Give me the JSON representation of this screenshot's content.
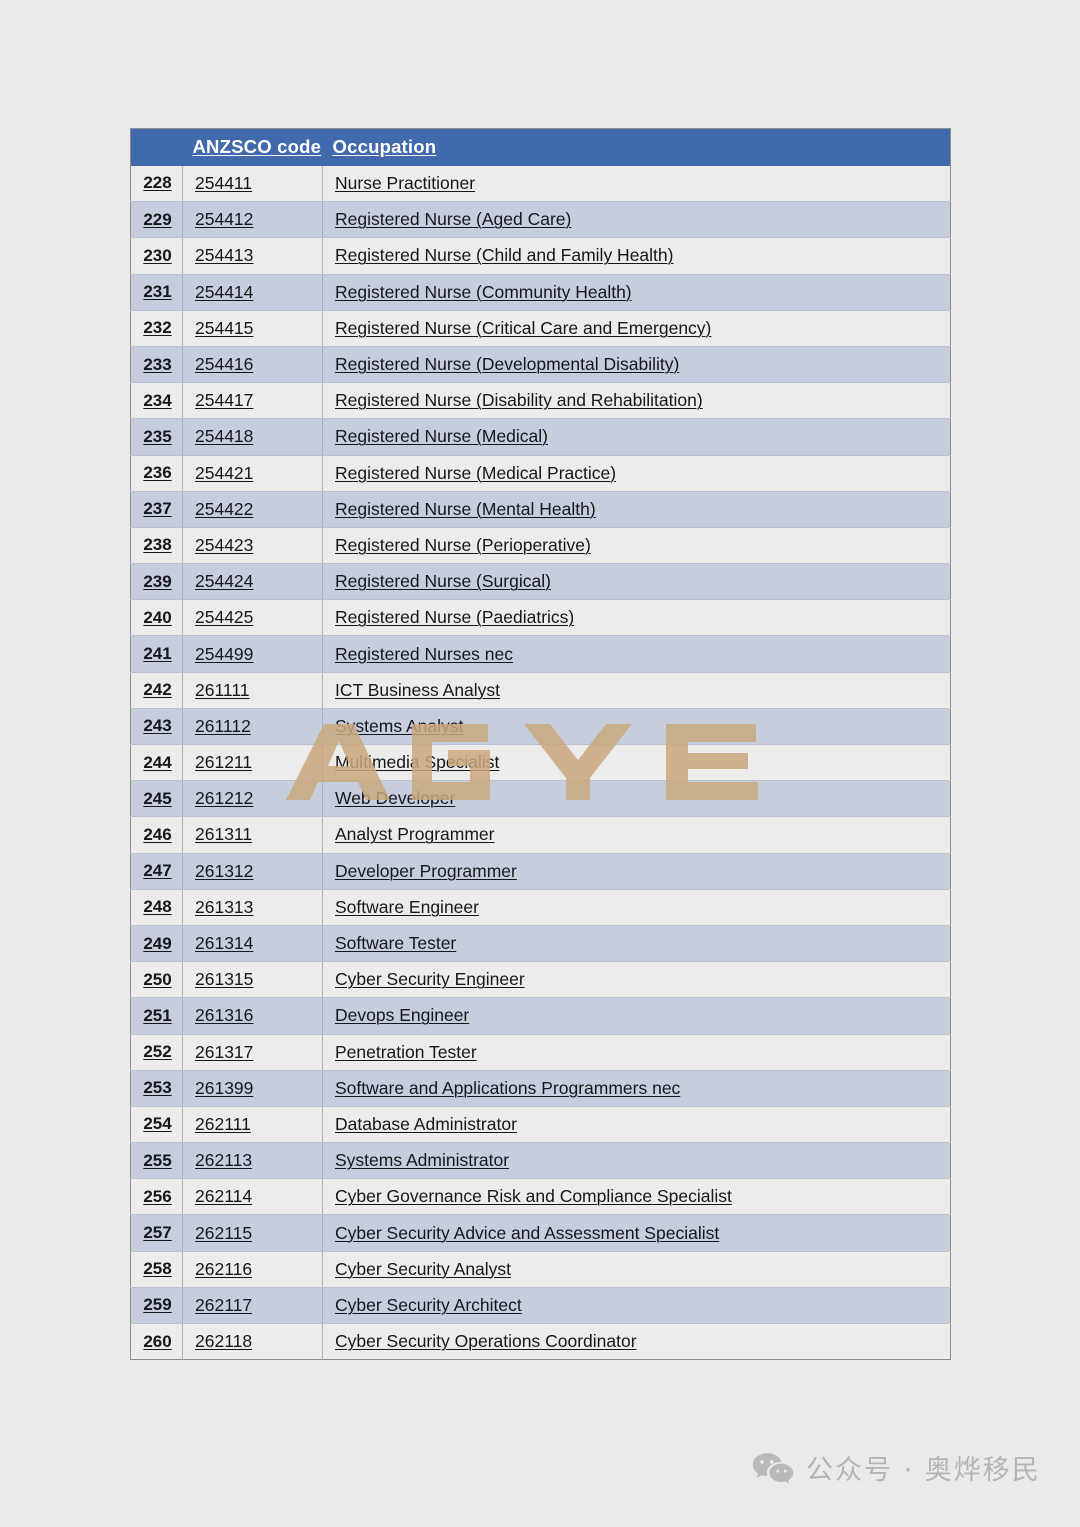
{
  "page": {
    "background_color": "#eaeaea",
    "header_color": "#406aab",
    "row_color_odd": "#edecea",
    "row_color_even": "#c6cede",
    "text_color": "#16171b"
  },
  "table": {
    "columns": [
      "",
      "ANZSCO code",
      "Occupation"
    ],
    "rows": [
      {
        "num": "228",
        "code": "254411",
        "occupation": "Nurse Practitioner"
      },
      {
        "num": "229",
        "code": "254412",
        "occupation": "Registered Nurse (Aged Care)"
      },
      {
        "num": "230",
        "code": "254413",
        "occupation": "Registered Nurse (Child and Family Health)"
      },
      {
        "num": "231",
        "code": "254414",
        "occupation": "Registered Nurse (Community Health)"
      },
      {
        "num": "232",
        "code": "254415",
        "occupation": "Registered Nurse (Critical Care and Emergency)"
      },
      {
        "num": "233",
        "code": "254416",
        "occupation": "Registered Nurse (Developmental Disability)"
      },
      {
        "num": "234",
        "code": "254417",
        "occupation": "Registered Nurse (Disability and Rehabilitation)"
      },
      {
        "num": "235",
        "code": "254418",
        "occupation": "Registered Nurse (Medical)"
      },
      {
        "num": "236",
        "code": "254421",
        "occupation": "Registered Nurse (Medical Practice)"
      },
      {
        "num": "237",
        "code": "254422",
        "occupation": "Registered Nurse (Mental Health)"
      },
      {
        "num": "238",
        "code": "254423",
        "occupation": "Registered Nurse (Perioperative)"
      },
      {
        "num": "239",
        "code": "254424",
        "occupation": "Registered Nurse (Surgical)"
      },
      {
        "num": "240",
        "code": "254425",
        "occupation": "Registered Nurse (Paediatrics)"
      },
      {
        "num": "241",
        "code": "254499",
        "occupation": "Registered Nurses nec"
      },
      {
        "num": "242",
        "code": "261111",
        "occupation": "ICT Business Analyst"
      },
      {
        "num": "243",
        "code": "261112",
        "occupation": "Systems Analyst"
      },
      {
        "num": "244",
        "code": "261211",
        "occupation": "Multimedia Specialist"
      },
      {
        "num": "245",
        "code": "261212",
        "occupation": "Web Developer"
      },
      {
        "num": "246",
        "code": "261311",
        "occupation": "Analyst Programmer"
      },
      {
        "num": "247",
        "code": "261312",
        "occupation": "Developer Programmer"
      },
      {
        "num": "248",
        "code": "261313",
        "occupation": "Software Engineer"
      },
      {
        "num": "249",
        "code": "261314",
        "occupation": "Software Tester"
      },
      {
        "num": "250",
        "code": "261315",
        "occupation": "Cyber Security Engineer"
      },
      {
        "num": "251",
        "code": "261316",
        "occupation": "Devops Engineer"
      },
      {
        "num": "252",
        "code": "261317",
        "occupation": "Penetration Tester"
      },
      {
        "num": "253",
        "code": "261399",
        "occupation": "Software and Applications Programmers nec"
      },
      {
        "num": "254",
        "code": "262111",
        "occupation": "Database Administrator"
      },
      {
        "num": "255",
        "code": "262113",
        "occupation": "Systems Administrator"
      },
      {
        "num": "256",
        "code": "262114",
        "occupation": "Cyber Governance Risk and Compliance Specialist"
      },
      {
        "num": "257",
        "code": "262115",
        "occupation": "Cyber Security Advice and Assessment Specialist"
      },
      {
        "num": "258",
        "code": "262116",
        "occupation": "Cyber Security Analyst"
      },
      {
        "num": "259",
        "code": "262117",
        "occupation": "Cyber Security Architect"
      },
      {
        "num": "260",
        "code": "262118",
        "occupation": "Cyber Security Operations Coordinator"
      }
    ]
  },
  "watermark": {
    "text": "AOYE",
    "color": "#c9a87c"
  },
  "footer": {
    "icon": "wechat-icon",
    "text": "公众号 · 奥烨移民",
    "color": "#b4b4b4"
  }
}
